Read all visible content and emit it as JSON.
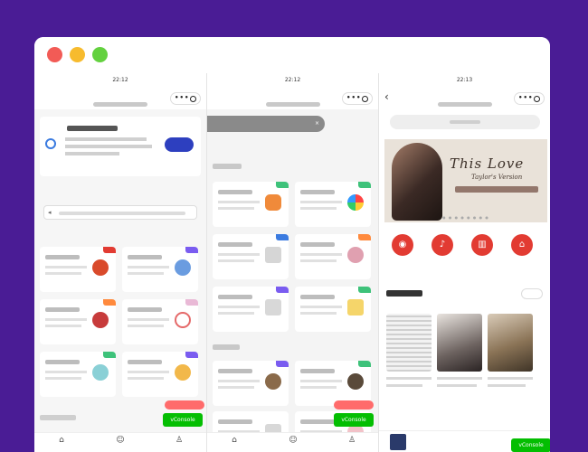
{
  "window": {
    "controls": [
      "close",
      "minimize",
      "maximize"
    ]
  },
  "phone1": {
    "status": {
      "carrier": "",
      "time": "22:12",
      "battery": ""
    },
    "toast": {
      "text": "",
      "close": "×"
    },
    "share_card": {
      "button": ""
    },
    "slogan": "",
    "notice": {
      "text": ""
    },
    "section_title": "",
    "float_button": "",
    "vconsole": "vConsole",
    "tabs": [
      {
        "label": ""
      },
      {
        "label": ""
      },
      {
        "label": ""
      }
    ]
  },
  "phone2": {
    "status": {
      "carrier": "",
      "time": "22:12",
      "battery": ""
    },
    "toast": {
      "text": "",
      "close": "×"
    },
    "section_title_1": "",
    "section_title_2": "",
    "float_button": "",
    "vconsole": "vConsole",
    "tabs": [
      {
        "label": ""
      },
      {
        "label": ""
      },
      {
        "label": ""
      }
    ]
  },
  "phone3": {
    "status": {
      "carrier": "",
      "time": "22:13",
      "battery": ""
    },
    "search_placeholder": "",
    "banner": {
      "title": "This Love",
      "subtitle": "Taylor's Version",
      "caption": ""
    },
    "menu": [
      {
        "label": ""
      },
      {
        "label": ""
      },
      {
        "label": ""
      },
      {
        "label": ""
      }
    ],
    "recommend_title": "",
    "more_button": "",
    "playlists": [
      {
        "name": ""
      },
      {
        "name": ""
      },
      {
        "name": ""
      }
    ],
    "player": {
      "song": "",
      "artist": ""
    },
    "vconsole": "vConsole"
  },
  "colors": {
    "background": "#4a1c95",
    "accent_red": "#e23b32",
    "vconsole_green": "#04be02"
  }
}
